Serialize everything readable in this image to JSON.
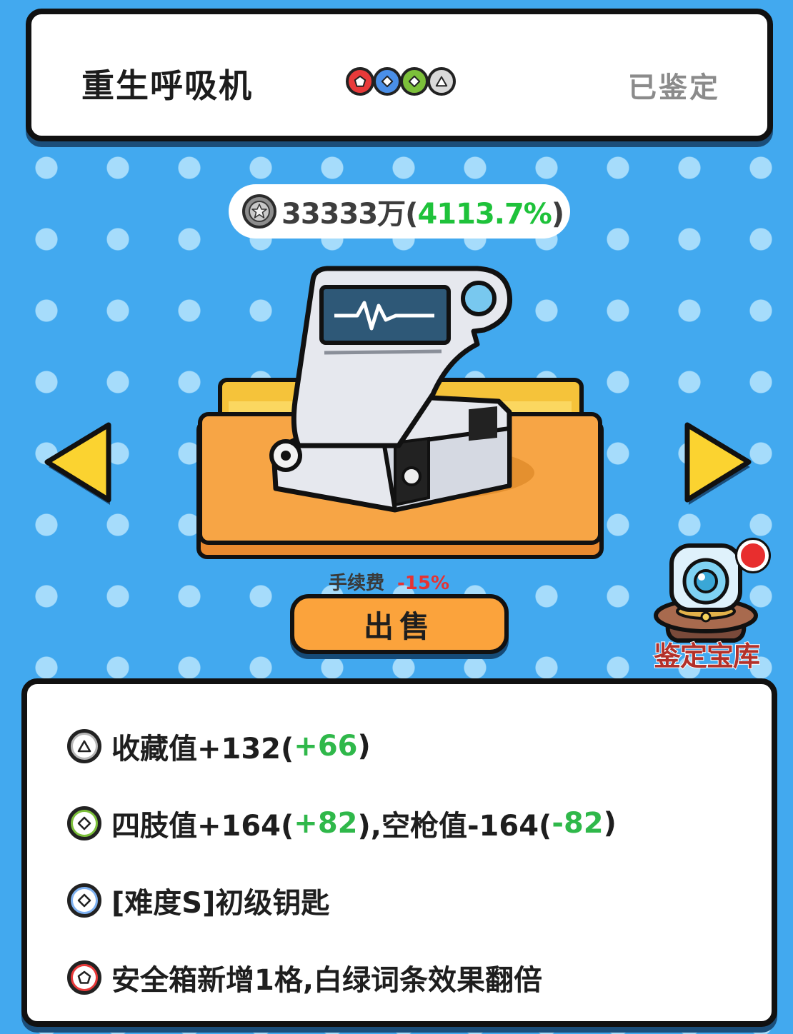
{
  "header": {
    "item_name": "重生呼吸机",
    "status": "已鉴定",
    "rarity_icons": [
      {
        "icon": "pentagon-icon",
        "color": "#e83a3a"
      },
      {
        "icon": "diamond-icon",
        "color": "#4a8fe8"
      },
      {
        "icon": "diamond-icon",
        "color": "#7cc03a"
      },
      {
        "icon": "triangle-icon",
        "color": "#bdbdbd"
      }
    ]
  },
  "price": {
    "icon": "silver-coin-icon",
    "value": "33333万",
    "open": "(",
    "percent": "4113.7%",
    "close": ")"
  },
  "item_art": {
    "icon": "ventilator-machine-icon"
  },
  "fee": {
    "label": "手续费",
    "value": "-15%"
  },
  "sell_button": {
    "label": "出售"
  },
  "vault": {
    "label": "鉴定宝库",
    "icon": "vault-machine-icon",
    "has_notification": true
  },
  "effects": [
    {
      "badge": "triangle-icon",
      "color": "#b8b8b8",
      "parts": [
        "收藏值+132(",
        "+66",
        ")"
      ]
    },
    {
      "badge": "diamond-icon",
      "color": "#7cc03a",
      "parts": [
        "四肢值+164(",
        "+82",
        "),空枪值-164(",
        "-82",
        ")"
      ]
    },
    {
      "badge": "diamond-icon",
      "color": "#7fb2f2",
      "parts": [
        "[难度S]初级钥匙"
      ]
    },
    {
      "badge": "pentagon-icon",
      "color": "#e83a3a",
      "parts": [
        "安全箱新增1格,白绿词条效果翻倍"
      ]
    }
  ],
  "nav": {
    "prev_icon": "arrow-left-icon",
    "next_icon": "arrow-right-icon"
  },
  "colors": {
    "background": "#42a9ef",
    "positive": "#1ec23a",
    "negative": "#e63232",
    "button": "#fba33c"
  }
}
